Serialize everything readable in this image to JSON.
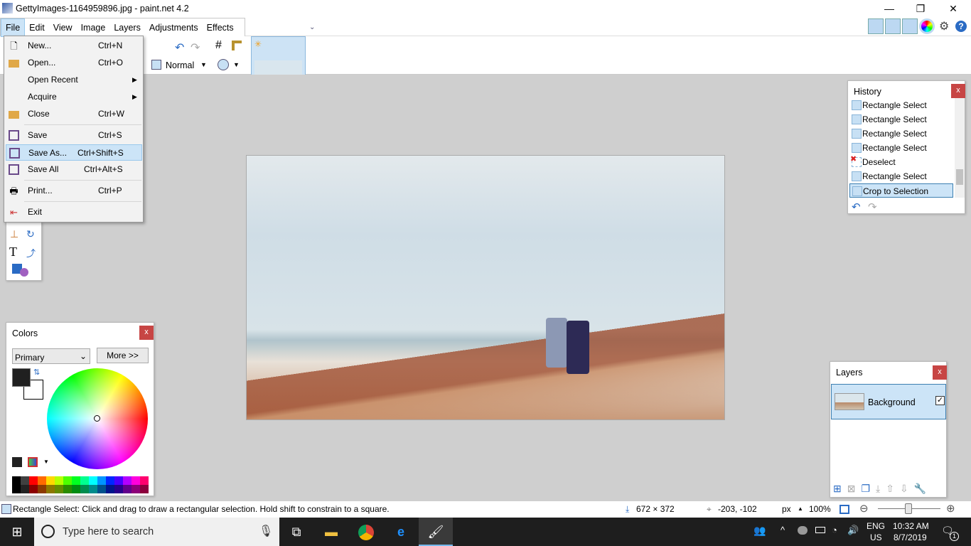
{
  "window": {
    "title": "GettyImages-1164959896.jpg - paint.net 4.2",
    "minimize": "—",
    "maximize": "❐",
    "close": "✕"
  },
  "menubar": [
    "File",
    "Edit",
    "View",
    "Image",
    "Layers",
    "Adjustments",
    "Effects"
  ],
  "toolbar": {
    "blend_mode": "Normal"
  },
  "file_menu": [
    {
      "label": "New...",
      "shortcut": "Ctrl+N",
      "icon": "new-file-icon"
    },
    {
      "label": "Open...",
      "shortcut": "Ctrl+O",
      "icon": "open-folder-icon"
    },
    {
      "label": "Open Recent",
      "submenu": true
    },
    {
      "label": "Acquire",
      "submenu": true
    },
    {
      "label": "Close",
      "shortcut": "Ctrl+W",
      "icon": "close-file-icon"
    },
    {
      "label": "Save",
      "shortcut": "Ctrl+S",
      "icon": "save-icon"
    },
    {
      "label": "Save As...",
      "shortcut": "Ctrl+Shift+S",
      "icon": "save-as-icon",
      "highlighted": true
    },
    {
      "label": "Save All",
      "shortcut": "Ctrl+Alt+S",
      "icon": "save-all-icon"
    },
    {
      "label": "Print...",
      "shortcut": "Ctrl+P",
      "icon": "print-icon"
    },
    {
      "label": "Exit",
      "icon": "exit-icon"
    }
  ],
  "history": {
    "title": "History",
    "items": [
      "Rectangle Select",
      "Rectangle Select",
      "Rectangle Select",
      "Rectangle Select",
      "Deselect",
      "Rectangle Select",
      "Crop to Selection"
    ],
    "selected": "Crop to Selection"
  },
  "colors": {
    "title": "Colors",
    "mode": "Primary",
    "more_button": "More >>",
    "primary": "#202020",
    "secondary": "#ffffff",
    "palette": [
      "#000000",
      "#404040",
      "#ff0000",
      "#ff6a00",
      "#ffd800",
      "#b6ff00",
      "#4cff00",
      "#00ff21",
      "#00ff90",
      "#00ffff",
      "#0094ff",
      "#0026ff",
      "#4800ff",
      "#b200ff",
      "#ff00dc",
      "#ff006e"
    ]
  },
  "layers": {
    "title": "Layers",
    "items": [
      {
        "name": "Background",
        "visible": true
      }
    ]
  },
  "statusbar": {
    "hint": "Rectangle Select: Click and drag to draw a rectangular selection. Hold shift to constrain to a square.",
    "size": "672 × 372",
    "position": "-203, -102",
    "unit": "px",
    "zoom": "100%"
  },
  "taskbar": {
    "search_placeholder": "Type here to search",
    "lang1": "ENG",
    "lang2": "US",
    "time": "10:32 AM",
    "date": "8/7/2019",
    "notifications": "1"
  }
}
